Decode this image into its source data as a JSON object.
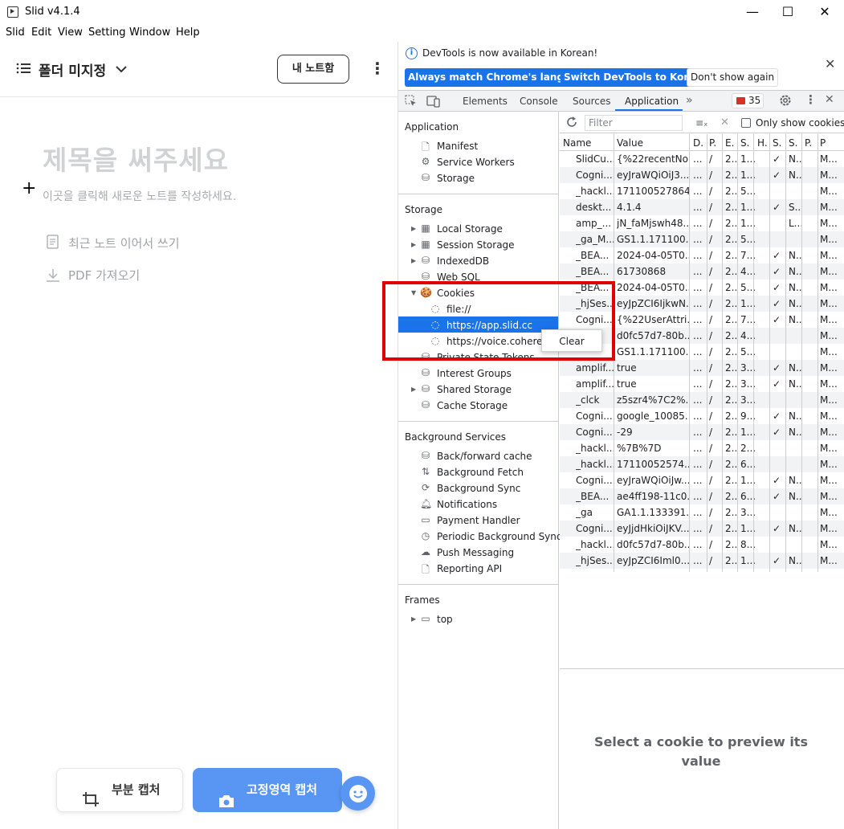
{
  "window": {
    "title": "Slid v4.1.4",
    "minimize": "—",
    "maximize": "☐",
    "close": "✕"
  },
  "menu": [
    "Slid",
    "Edit",
    "View",
    "Setting",
    "Window",
    "Help"
  ],
  "left": {
    "folder": "폴더 미지정",
    "my_notes": "내 노트함",
    "placeholder_title": "제목을 써주세요",
    "placeholder_hint": "이곳을 클릭해 새로운 노트를 작성하세요.",
    "continue_recent": "최근 노트 이어서 쓰기",
    "import_pdf": "PDF 가져오기",
    "partial_capture": "부분 캡처",
    "fixed_capture": "고정영역 캡처"
  },
  "devtools": {
    "info_text": "DevTools is now available in Korean!",
    "btn_match": "Always match Chrome's language",
    "btn_switch": "Switch DevTools to Korean",
    "btn_dont": "Don't show again",
    "tabs": [
      "Elements",
      "Console",
      "Sources",
      "Application"
    ],
    "active_tab": "Application",
    "error_count": "35",
    "filter_placeholder": "Filter",
    "only_show_cookies": "Only show cookies w",
    "sidebar": {
      "application_head": "Application",
      "application_items": [
        "Manifest",
        "Service Workers",
        "Storage"
      ],
      "storage_head": "Storage",
      "storage_items": [
        "Local Storage",
        "Session Storage",
        "IndexedDB",
        "Web SQL",
        "Cookies",
        "file://",
        "https://app.slid.cc",
        "https://voice.cohere.sc",
        "Private State Tokens",
        "Interest Groups",
        "Shared Storage",
        "Cache Storage"
      ],
      "background_head": "Background Services",
      "background_items": [
        "Back/forward cache",
        "Background Fetch",
        "Background Sync",
        "Notifications",
        "Payment Handler",
        "Periodic Background Sync",
        "Push Messaging",
        "Reporting API"
      ],
      "frames_head": "Frames",
      "frames_items": [
        "top"
      ]
    },
    "context_menu": "Clear",
    "columns": [
      "Name",
      "Value",
      "D.",
      "P.",
      "E.",
      "S.",
      "H.",
      "S.",
      "S.",
      "P.",
      "P"
    ],
    "rows": [
      [
        "SlidCu...",
        "{%22recentNo...",
        "...",
        "/",
        "2...",
        "1...",
        "",
        "✓",
        "N...",
        "",
        "M..."
      ],
      [
        "Cogni...",
        "eyJraWQiOiJ3...",
        "...",
        "/",
        "2...",
        "1...",
        "",
        "✓",
        "N...",
        "",
        "M..."
      ],
      [
        "_hackl...",
        "1711005278645",
        "...",
        "/",
        "2...",
        "5...",
        "",
        "",
        "",
        "",
        "M..."
      ],
      [
        "deskt...",
        "4.1.4",
        "...",
        "/",
        "2...",
        "1...",
        "",
        "✓",
        "S...",
        "",
        "M..."
      ],
      [
        "amp_...",
        "jN_faMjswh48...",
        "...",
        "/",
        "2...",
        "1...",
        "",
        "",
        "L...",
        "",
        "M..."
      ],
      [
        "_ga_M...",
        "GS1.1.171100...",
        "...",
        "/",
        "2...",
        "5...",
        "",
        "",
        "",
        "",
        "M..."
      ],
      [
        "_BEA...",
        "2024-04-05T0...",
        "...",
        "/",
        "2...",
        "7...",
        "",
        "✓",
        "N...",
        "",
        "M..."
      ],
      [
        "_BEA...",
        "61730868",
        "...",
        "/",
        "2...",
        "4...",
        "",
        "✓",
        "N...",
        "",
        "M..."
      ],
      [
        "_BEA...",
        "2024-04-05T0...",
        "...",
        "/",
        "2...",
        "5...",
        "",
        "✓",
        "N...",
        "",
        "M..."
      ],
      [
        "_hjSes...",
        "eyJpZCI6IjkwN...",
        "...",
        "/",
        "2...",
        "1...",
        "",
        "✓",
        "N...",
        "",
        "M..."
      ],
      [
        "Cogni...",
        "{%22UserAttri...",
        "...",
        "/",
        "2...",
        "7...",
        "",
        "✓",
        "N...",
        "",
        "M..."
      ],
      [
        "",
        "d0fc57d7-80b...",
        "...",
        "/",
        "2...",
        "4...",
        "",
        "",
        "",
        "",
        "M..."
      ],
      [
        "",
        "GS1.1.171100...",
        "...",
        "/",
        "2...",
        "5...",
        "",
        "",
        "",
        "",
        "M..."
      ],
      [
        "amplif...",
        "true",
        "...",
        "/",
        "2...",
        "3...",
        "",
        "✓",
        "N...",
        "",
        "M..."
      ],
      [
        "amplif...",
        "true",
        "...",
        "/",
        "2...",
        "3...",
        "",
        "✓",
        "N...",
        "",
        "M..."
      ],
      [
        "_clck",
        "z5szr4%7C2%...",
        "...",
        "/",
        "2...",
        "3...",
        "",
        "",
        "",
        "",
        "M..."
      ],
      [
        "Cogni...",
        "google_10085...",
        "...",
        "/",
        "2...",
        "9...",
        "",
        "✓",
        "N...",
        "",
        "M..."
      ],
      [
        "Cogni...",
        "-29",
        "...",
        "/",
        "2...",
        "1...",
        "",
        "✓",
        "N...",
        "",
        "M..."
      ],
      [
        "_hackl...",
        "%7B%7D",
        "...",
        "/",
        "2...",
        "2...",
        "",
        "",
        "",
        "",
        "M..."
      ],
      [
        "_hackl...",
        "17110052574...",
        "...",
        "/",
        "2...",
        "6...",
        "",
        "",
        "",
        "",
        "M..."
      ],
      [
        "Cogni...",
        "eyJraWQiOiJw...",
        "...",
        "/",
        "2...",
        "1...",
        "",
        "✓",
        "N...",
        "",
        "M..."
      ],
      [
        "_BEA...",
        "ae4ff198-11c0...",
        "...",
        "/",
        "2...",
        "6...",
        "",
        "✓",
        "N...",
        "",
        "M..."
      ],
      [
        "_ga",
        "GA1.1.133391...",
        "...",
        "/",
        "2...",
        "3...",
        "",
        "",
        "",
        "",
        "M..."
      ],
      [
        "Cogni...",
        "eyJjdHkiOiJKV...",
        "...",
        "/",
        "2...",
        "1...",
        "",
        "✓",
        "N...",
        "",
        "M..."
      ],
      [
        "_hackl...",
        "d0fc57d7-80b...",
        "...",
        "/",
        "2...",
        "8...",
        "",
        "",
        "",
        "",
        "M..."
      ],
      [
        "_hjSes...",
        "eyJpZCI6Iml0...",
        "...",
        "/",
        "2...",
        "1...",
        "",
        "✓",
        "N...",
        "",
        "M..."
      ]
    ],
    "preview_text": "Select a cookie to preview its value"
  }
}
